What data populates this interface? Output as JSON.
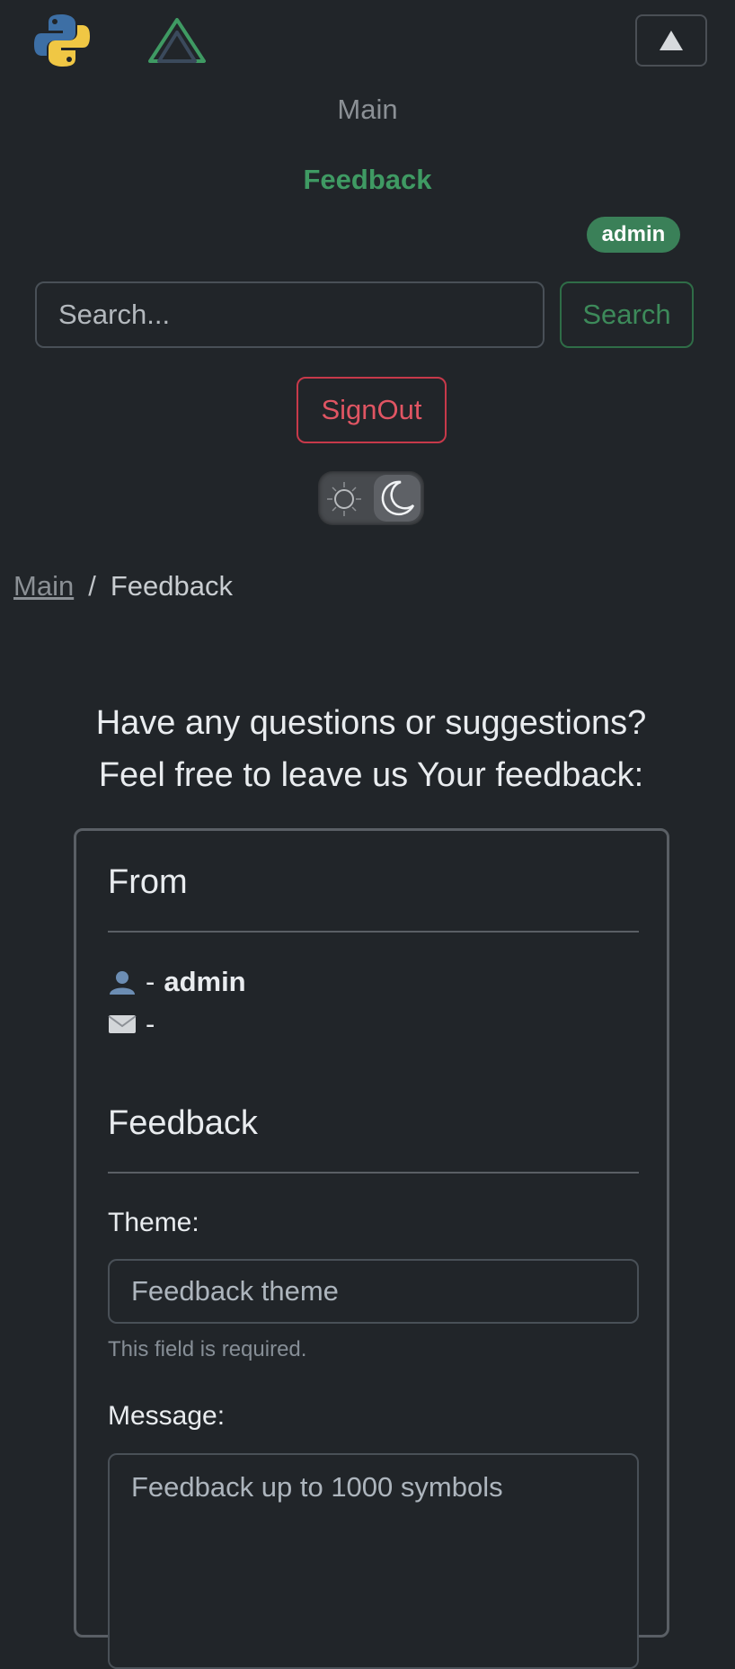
{
  "navbar": {
    "main_link": "Main",
    "active_link": "Feedback",
    "user_badge": "admin",
    "search_placeholder": "Search...",
    "search_button": "Search",
    "signout_button": "SignOut"
  },
  "breadcrumb": {
    "main": "Main",
    "separator": "/",
    "current": "Feedback"
  },
  "intro": {
    "line1": "Have any questions or suggestions?",
    "line2": "Feel free to leave us Your feedback:"
  },
  "form": {
    "from_heading": "From",
    "user_name": "admin",
    "email_value": "",
    "dash": "-",
    "feedback_heading": "Feedback",
    "theme_label": "Theme:",
    "theme_placeholder": "Feedback theme",
    "theme_help": "This field is required.",
    "message_label": "Message:",
    "message_placeholder": "Feedback up to 1000 symbols"
  },
  "colors": {
    "background": "#212529",
    "success": "#3f9a63",
    "danger": "#e05563"
  },
  "icons": [
    "python-logo",
    "vue-logo",
    "caret-up-icon",
    "sun-icon",
    "moon-icon",
    "user-icon",
    "envelope-icon"
  ]
}
